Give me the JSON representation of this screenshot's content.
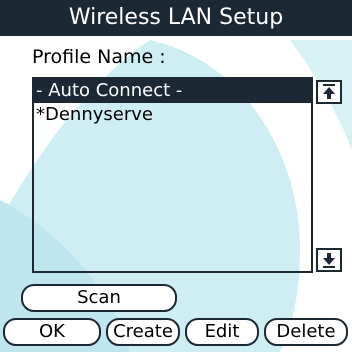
{
  "window": {
    "title": "Wireless LAN Setup"
  },
  "profile": {
    "label": "Profile Name :",
    "items": [
      {
        "label": "- Auto Connect -",
        "selected": true
      },
      {
        "label": "*Dennyserve",
        "selected": false
      }
    ]
  },
  "scroll": {
    "up_icon": "scroll-up-icon",
    "down_icon": "scroll-down-icon"
  },
  "buttons": {
    "scan": "Scan",
    "ok": "OK",
    "create": "Create",
    "edit": "Edit",
    "delete": "Delete"
  },
  "colors": {
    "title_bar": "#1c2834",
    "wallpaper": "#cfeef4",
    "selection": "#1c2834"
  }
}
